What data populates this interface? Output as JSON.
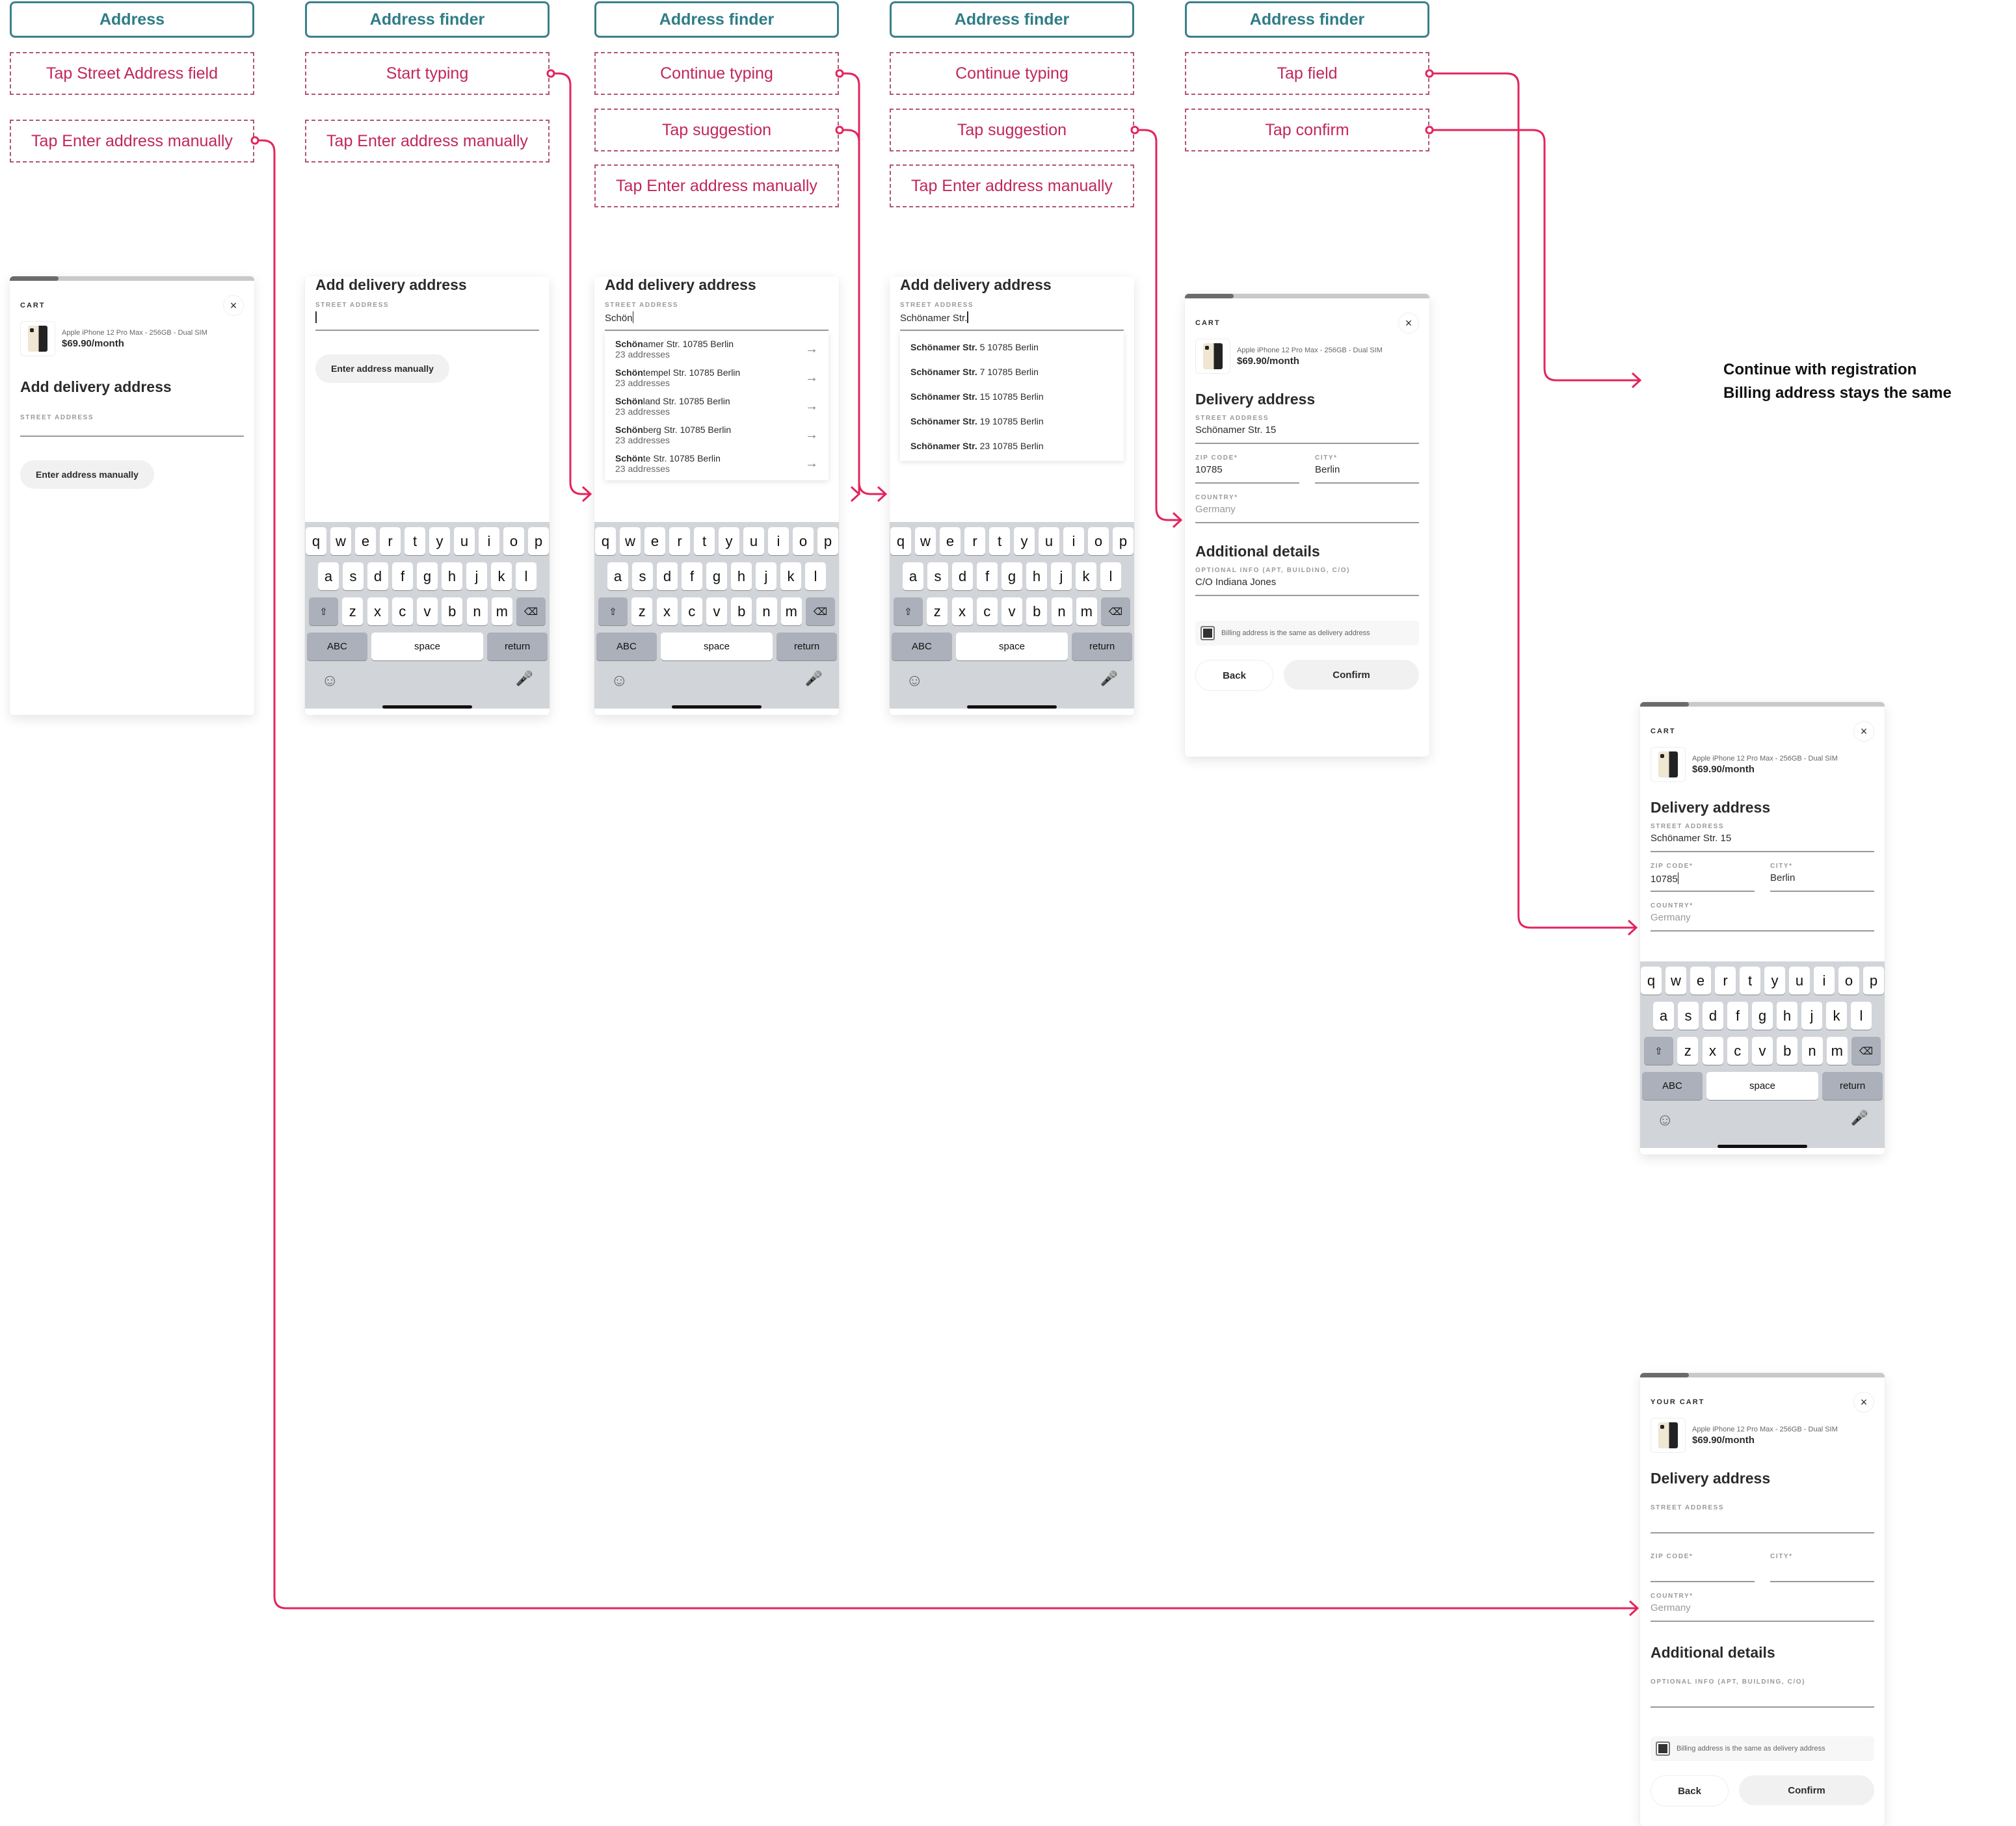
{
  "colors": {
    "header_teal": "#2f7c86",
    "action_pink": "#c1275a",
    "connector": "#e3245c"
  },
  "columns": [
    {
      "header": "Address",
      "actions": [
        "Tap Street Address field",
        "Tap Enter address manually"
      ]
    },
    {
      "header": "Address finder",
      "actions": [
        "Start typing",
        "Tap Enter address manually"
      ]
    },
    {
      "header": "Address finder",
      "actions": [
        "Continue typing",
        "Tap suggestion",
        "Tap Enter address manually"
      ]
    },
    {
      "header": "Address finder",
      "actions": [
        "Continue typing",
        "Tap suggestion",
        "Tap Enter address manually"
      ]
    },
    {
      "header": "Address finder",
      "actions": [
        "Tap field",
        "Tap confirm"
      ]
    }
  ],
  "note": {
    "line1": "Continue with registration",
    "line2": "Billing address stays the same"
  },
  "common": {
    "cart_label": "CART",
    "your_cart_label": "YOUR CART",
    "close_icon": "×",
    "product_name": "Apple iPhone 12 Pro Max - 256GB - Dual SIM",
    "product_price": "$69.90/month",
    "add_title": "Add delivery address",
    "delivery_title": "Delivery address",
    "additional_title": "Additional details",
    "street_label": "STREET ADDRESS",
    "zip_label": "ZIP CODE*",
    "city_label": "CITY*",
    "country_label": "COUNTRY*",
    "optional_label": "OPTIONAL INFO (APT, BUILDING, C/O)",
    "country_placeholder": "Germany",
    "manual_button": "Enter address manually",
    "billing_checkbox": "Billing address is the same as delivery address",
    "back_button": "Back",
    "confirm_button": "Confirm"
  },
  "screens": {
    "s1": {
      "progress": 0.2
    },
    "s2": {
      "street_value": ""
    },
    "s3": {
      "street_value": "Schön",
      "suggestions": [
        {
          "bold": "Schön",
          "rest": "amer Str. 10785 Berlin",
          "sub": "23 addresses"
        },
        {
          "bold": "Schön",
          "rest": "tempel Str. 10785 Berlin",
          "sub": "23 addresses"
        },
        {
          "bold": "Schön",
          "rest": "land Str. 10785 Berlin",
          "sub": "23 addresses"
        },
        {
          "bold": "Schön",
          "rest": "berg Str. 10785 Berlin",
          "sub": "23 addresses"
        },
        {
          "bold": "Schön",
          "rest": "te Str. 10785 Berlin",
          "sub": "23 addresses"
        }
      ]
    },
    "s4": {
      "street_value": "Schönamer Str.",
      "suggestions": [
        {
          "bold": "Schönamer Str.",
          "rest": " 5 10785 Berlin"
        },
        {
          "bold": "Schönamer Str.",
          "rest": " 7 10785 Berlin"
        },
        {
          "bold": "Schönamer Str.",
          "rest": " 15 10785 Berlin"
        },
        {
          "bold": "Schönamer Str.",
          "rest": " 19 10785 Berlin"
        },
        {
          "bold": "Schönamer Str.",
          "rest": " 23 10785 Berlin"
        }
      ]
    },
    "s5": {
      "progress": 0.2,
      "street_value": "Schönamer Str. 15",
      "zip_value": "10785",
      "city_value": "Berlin",
      "optional_value": "C/O Indiana Jones",
      "billing_checked": true
    },
    "s6": {
      "progress": 0.2,
      "street_value": "Schönamer Str. 15",
      "zip_value": "10785",
      "city_value": "Berlin"
    },
    "s7": {
      "progress": 0.2,
      "street_value": "",
      "zip_value": "",
      "city_value": "",
      "optional_value": "",
      "billing_checked": true
    }
  },
  "keyboard": {
    "row1": [
      "q",
      "w",
      "e",
      "r",
      "t",
      "y",
      "u",
      "i",
      "o",
      "p"
    ],
    "row2": [
      "a",
      "s",
      "d",
      "f",
      "g",
      "h",
      "j",
      "k",
      "l"
    ],
    "row3": [
      "z",
      "x",
      "c",
      "v",
      "b",
      "n",
      "m"
    ],
    "shift_icon": "⇧",
    "delete_icon": "⌫",
    "abc": "ABC",
    "space": "space",
    "return": "return",
    "emoji_icon": "☺",
    "mic_icon": "🎙"
  }
}
